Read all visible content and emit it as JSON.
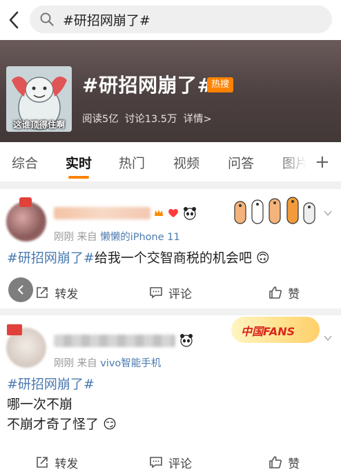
{
  "search": {
    "query": "#研招网崩了#"
  },
  "header": {
    "title": "#研招网崩了#",
    "badge": "热搜",
    "image_caption": "这谁顶得住啊",
    "reads": "阅读5亿",
    "discussions": "讨论13.5万",
    "details": "详情>"
  },
  "tabs": [
    {
      "label": "综合",
      "active": false
    },
    {
      "label": "实时",
      "active": true
    },
    {
      "label": "热门",
      "active": false
    },
    {
      "label": "视频",
      "active": false
    },
    {
      "label": "问答",
      "active": false
    },
    {
      "label": "图片",
      "active": false
    }
  ],
  "posts": [
    {
      "time": "刚刚",
      "source_prefix": "来自",
      "source": "懒懒的iPhone 11",
      "tag": "#研招网崩了#",
      "text": "给我一个交智商税的机会吧",
      "emoji": "🙃"
    },
    {
      "time": "刚刚",
      "source_prefix": "来自",
      "source": "vivo智能手机",
      "tag": "#研招网崩了#",
      "line1": "哪一次不崩",
      "line2": "不崩才奇了怪了",
      "emoji": "😏",
      "fans_badge": "中国FANS"
    }
  ],
  "actions": {
    "repost": "转发",
    "comment": "评论",
    "like": "赞"
  },
  "colors": {
    "accent": "#ff8200",
    "link": "#4a7ab0",
    "header_bg": "#4c4040"
  }
}
